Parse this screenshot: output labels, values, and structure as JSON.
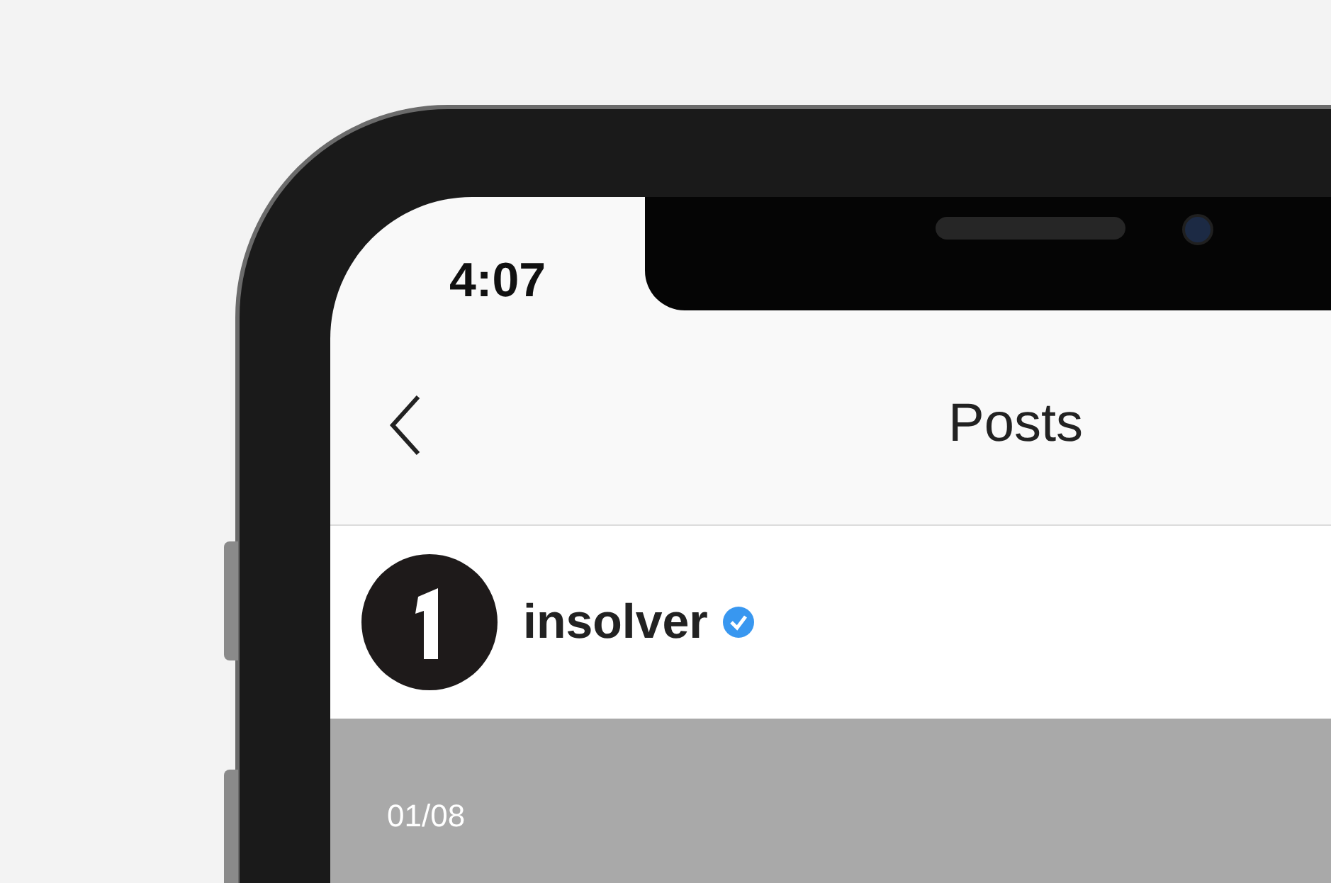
{
  "status_bar": {
    "time": "4:07"
  },
  "nav": {
    "title": "Posts"
  },
  "post": {
    "username": "insolver",
    "verified": true,
    "image_counter": "01/08"
  }
}
